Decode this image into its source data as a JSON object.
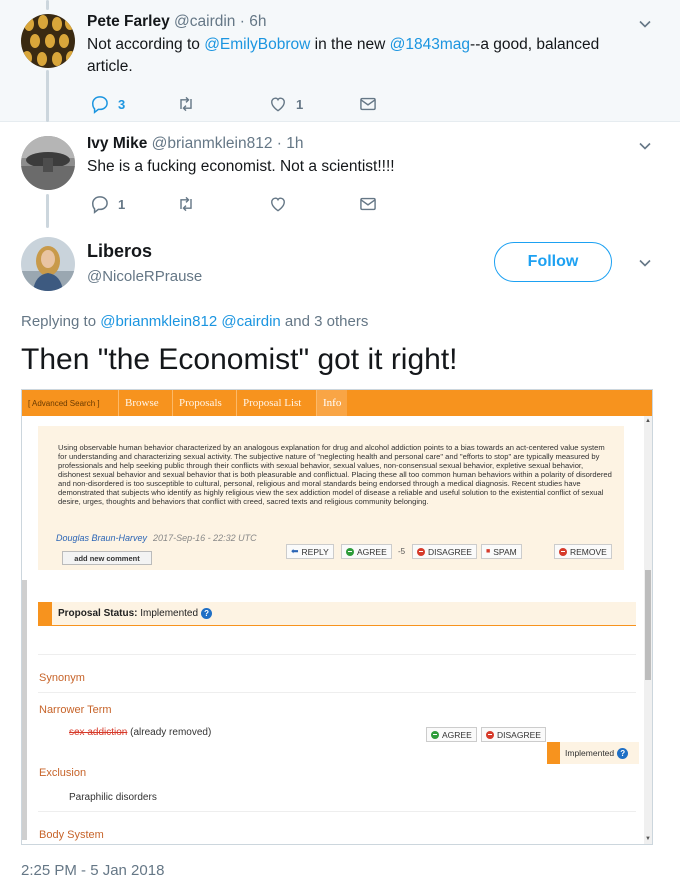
{
  "tweets": [
    {
      "name": "Pete Farley",
      "handle": "@cairdin",
      "time": "· 6h",
      "text_parts": [
        "Not according to ",
        "@EmilyBobrow",
        " in the new ",
        "@1843mag",
        "--a good, balanced article."
      ],
      "replies": "3",
      "retweets": "",
      "likes": "1"
    },
    {
      "name": "Ivy Mike",
      "handle": "@brianmklein812",
      "time": "· 1h",
      "text": "She is a fucking economist.  Not a scientist!!!!",
      "replies": "1",
      "retweets": "",
      "likes": ""
    }
  ],
  "main": {
    "name": "Liberos",
    "handle": "@NicoleRPrause",
    "follow_label": "Follow",
    "replying_prefix": "Replying to ",
    "replying_mentions": "@brianmklein812 @cairdin",
    "replying_suffix": " and 3 others",
    "text": "Then \"the Economist\" got it right!",
    "timestamp": "2:25 PM - 5 Jan 2018"
  },
  "embed": {
    "nav": [
      "[ Advanced Search ]",
      "Browse",
      "Proposals",
      "Proposal List",
      "Info"
    ],
    "comment": "Using observable human behavior characterized by an analogous explanation for drug and alcohol addiction points to a bias towards an act-centered value system for understanding and characterizing sexual activity. The subjective nature of \"neglecting health and personal care\" and \"efforts to stop\" are typically measured by professionals and help seeking public through their conflicts with sexual behavior, sexual values, non-consensual sexual behavior, expletive sexual behavior, dishonest sexual behavior and sexual behavior that is both pleasurable and conflictual. Placing these all too common human behaviors within a polarity of disordered and non-disordered is too susceptible to cultural, personal, religious and moral standards being endorsed through a medical diagnosis. Recent studies have demonstrated that subjects who identify as highly religious view the sex addiction model of disease a reliable and useful solution to the existential conflict of sexual desire, urges, thoughts and behaviors that conflict with creed, sacred texts and religious community belonging.",
    "author": "Douglas Braun-Harvey",
    "date": "2017-Sep-16 - 22:32 UTC",
    "add_comment": "add new comment",
    "buttons": {
      "reply": "REPLY",
      "agree": "AGREE",
      "agree_count": "-5",
      "disagree": "DISAGREE",
      "spam": "SPAM",
      "remove": "REMOVE"
    },
    "status_label": "Proposal Status:",
    "status_value": " Implemented",
    "sections": {
      "synonym": "Synonym",
      "narrower": "Narrower Term",
      "narrower_removed": "sex addiction",
      "narrower_note": " (already removed)",
      "agree": "AGREE",
      "disagree": "DISAGREE",
      "implemented": "Implemented",
      "exclusion": "Exclusion",
      "exclusion_item": "Paraphilic disorders",
      "body_system": "Body System"
    }
  },
  "colors": {
    "link": "#1b95e0",
    "follow": "#1da1f2",
    "muted": "#657786",
    "accent_orange": "#f7931e"
  }
}
